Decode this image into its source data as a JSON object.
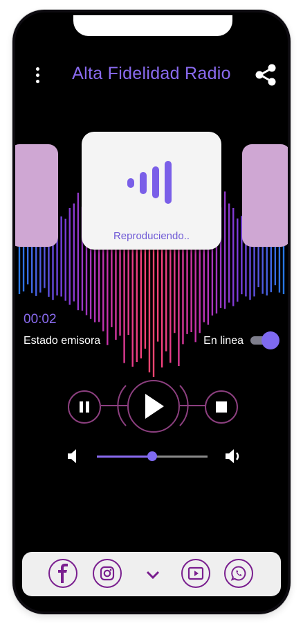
{
  "app": {
    "title": "Alta Fidelidad Radio"
  },
  "cover": {
    "status": "Reproduciendo.."
  },
  "player": {
    "elapsed": "00:02",
    "status_label": "Estado emisora",
    "online_label": "En linea",
    "online_toggle_on": true,
    "volume_level": 0.5
  },
  "icons": {
    "menu": "more-vert-icon",
    "share": "share-icon",
    "pause": "pause-icon",
    "play": "play-icon",
    "stop": "stop-icon",
    "volume_down": "volume-low-icon",
    "volume_up": "volume-high-icon",
    "facebook": "facebook-icon",
    "instagram": "instagram-icon",
    "expand": "chevron-down-icon",
    "youtube": "youtube-icon",
    "whatsapp": "whatsapp-icon"
  },
  "colors": {
    "accent": "#8a6bf0",
    "social_purple": "#7a1f8f",
    "side_card": "#cfa7d3",
    "control_ring": "#8c3f7f"
  }
}
